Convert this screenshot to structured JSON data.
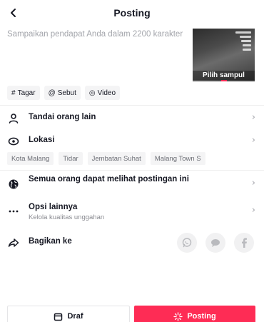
{
  "header": {
    "title": "Posting",
    "back_icon": "chevron-left-icon"
  },
  "caption": {
    "placeholder": "Sampaikan pendapat Anda dalam 2200 karakter"
  },
  "cover": {
    "label": "Pilih sampul"
  },
  "chips": [
    {
      "icon": "hashtag-icon",
      "symbol": "#",
      "label": "Tagar"
    },
    {
      "icon": "at-icon",
      "symbol": "@",
      "label": "Sebut"
    },
    {
      "icon": "video-icon",
      "symbol": "◎",
      "label": "Video"
    }
  ],
  "rows": {
    "tag_people": {
      "label": "Tandai orang lain",
      "icon": "person-icon"
    },
    "location": {
      "label": "Lokasi",
      "icon": "location-pin-icon"
    },
    "privacy": {
      "label": "Semua orang dapat melihat postingan ini",
      "icon": "globe-icon"
    },
    "more_options": {
      "label": "Opsi lainnya",
      "sub": "Kelola kualitas unggahan",
      "icon": "more-dots-icon"
    },
    "share": {
      "label": "Bagikan ke",
      "icon": "share-arrow-icon"
    }
  },
  "location_suggestions": [
    "Kota Malang",
    "Tidar",
    "Jembatan Suhat",
    "Malang Town S"
  ],
  "share_targets": [
    {
      "name": "whatsapp-icon"
    },
    {
      "name": "message-icon"
    },
    {
      "name": "facebook-icon"
    }
  ],
  "buttons": {
    "draft": "Draf",
    "post": "Posting"
  },
  "colors": {
    "accent": "#fe2c55",
    "text": "#161823",
    "muted": "#a3a5ab"
  }
}
